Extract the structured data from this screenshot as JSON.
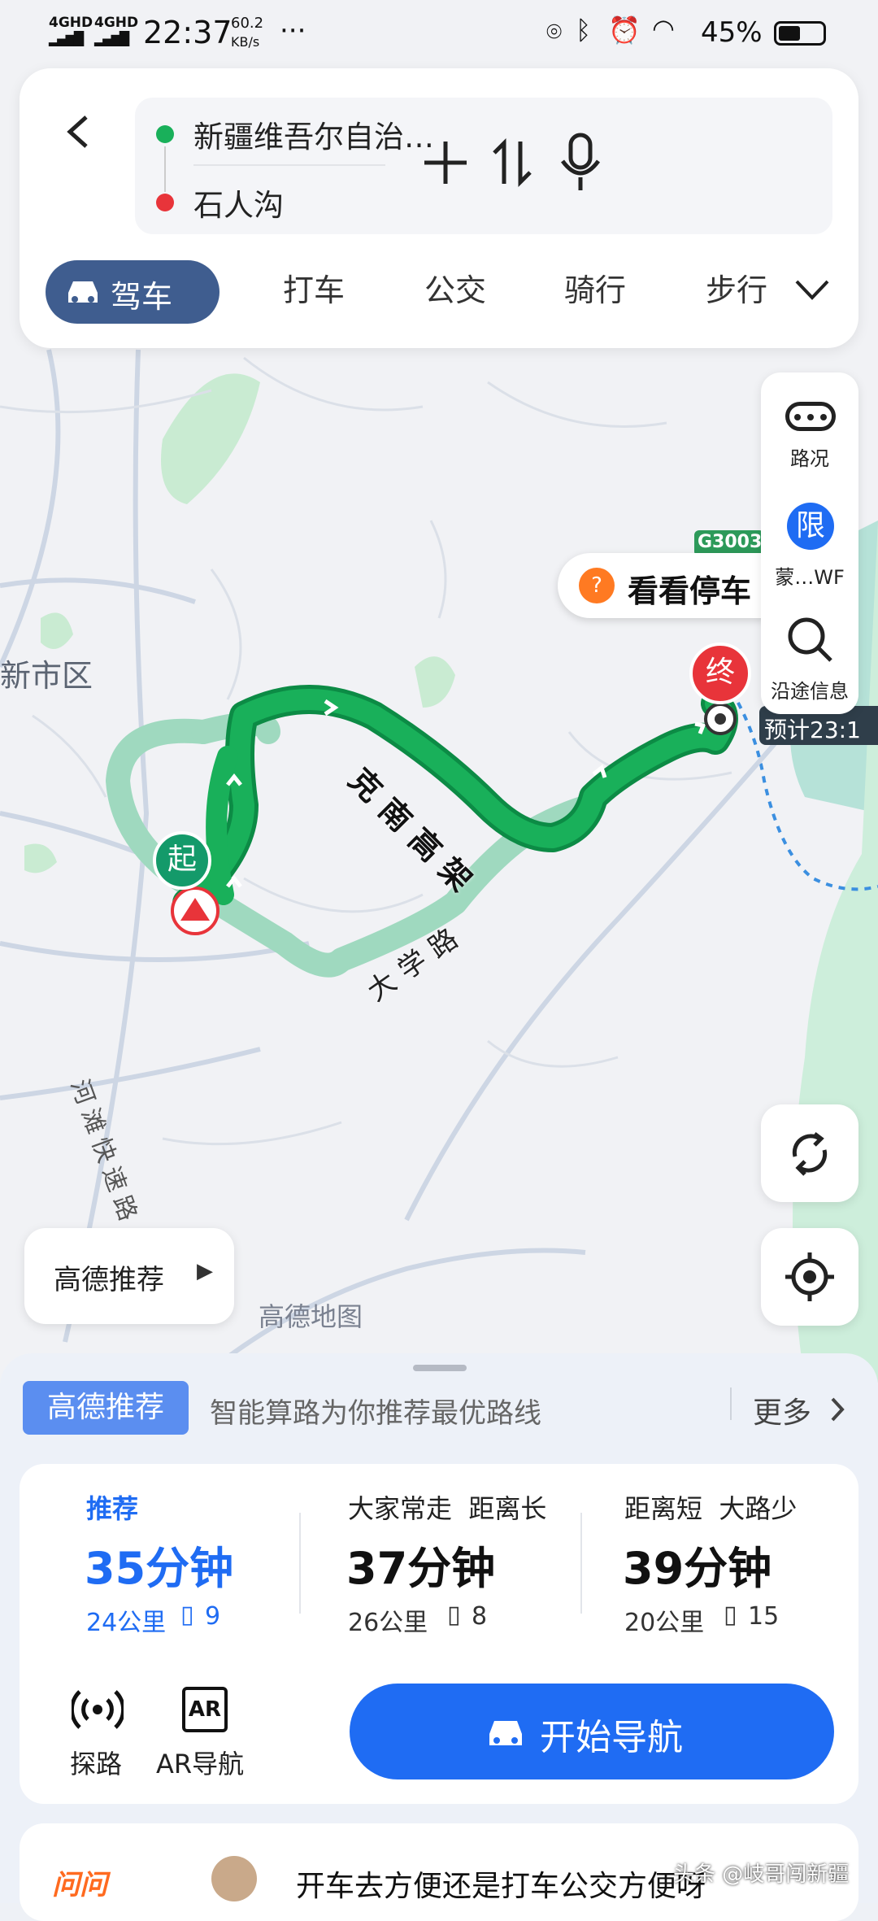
{
  "status_bar": {
    "signal1": "4GHD",
    "signal2": "4GHD",
    "time": "22:37",
    "net_speed": "60.2",
    "net_unit": "KB/s",
    "more": "···",
    "battery": "45%"
  },
  "route_input": {
    "origin": "新疆维吾尔自治…",
    "destination": "石人沟"
  },
  "modes": [
    {
      "label": "驾车"
    },
    {
      "label": "打车"
    },
    {
      "label": "公交"
    },
    {
      "label": "骑行"
    },
    {
      "label": "步行"
    }
  ],
  "map": {
    "district_label": "新市区",
    "road1": "克南高架",
    "road2": "大学路",
    "road3": "河滩快速路",
    "start_marker": "起",
    "end_marker": "终",
    "highway_shield": "G3003",
    "parking_bubble": "看看停车",
    "eta_label": "预计23:1",
    "watermark": "高德地图",
    "recommend_chip": "高德推荐"
  },
  "right_rail": {
    "traffic": "路况",
    "restrict_badge": "限",
    "restrict": "蒙…WF",
    "along_route": "沿途信息"
  },
  "panel": {
    "tag": "高德推荐",
    "desc": "智能算路为你推荐最优路线",
    "more": "更多"
  },
  "routes": [
    {
      "tag": "推荐",
      "time": "35分钟",
      "dist": "24公里",
      "lights": "9"
    },
    {
      "tag": "大家常走  距离长",
      "time": "37分钟",
      "dist": "26公里",
      "lights": "8"
    },
    {
      "tag": "距离短  大路少",
      "time": "39分钟",
      "dist": "20公里",
      "lights": "15"
    }
  ],
  "actions": {
    "explore": "探路",
    "ar_icon": "AR",
    "ar": "AR导航",
    "start_nav": "开始导航"
  },
  "bottom": {
    "ask_logo": "问问",
    "ask_text": "开车去方便还是打车公交方便呀",
    "watermark": "头条 @岐哥闯新疆"
  },
  "colors": {
    "accent": "#1f6cf3",
    "route_green": "#19b05a",
    "alt_route": "#9fd9bf",
    "mode_active": "#3f5d8f",
    "end_red": "#e8343a"
  }
}
